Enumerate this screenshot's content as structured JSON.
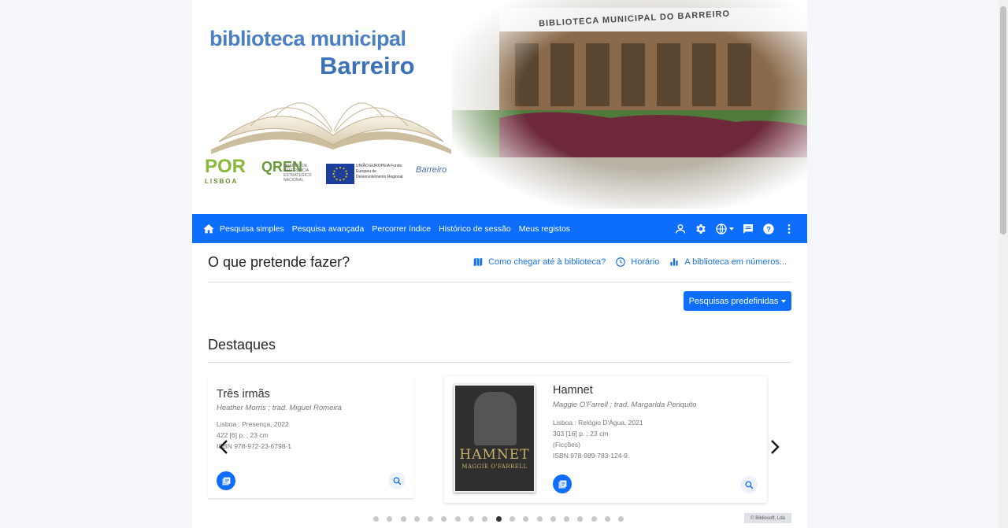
{
  "banner": {
    "brand_line1": "biblioteca municipal",
    "brand_line2": "Barreiro",
    "building_sign": "BIBLIOTECA MUNICIPAL DO BARREIRO",
    "logos": {
      "por": "POR",
      "por_sub": "LISBOA",
      "qren": "QREN",
      "qren_text": "QUADRO DE REFERÊNCIA ESTRATÉGICO NACIONAL",
      "eu_text": "UNIÃO EUROPEIA Fundo Europeu de Desenvolvimento Regional",
      "barreiro": "Barreiro"
    }
  },
  "nav": {
    "links": [
      "Pesquisa simples",
      "Pesquisa avançada",
      "Percorrer índice",
      "Histórico de sessão",
      "Meus registos"
    ],
    "icons": [
      "user-icon",
      "gear-icon",
      "globe-icon",
      "chat-icon",
      "help-icon",
      "more-vertical-icon"
    ]
  },
  "main": {
    "question": "O que pretende fazer?",
    "quick_links": [
      "Como chegar até à biblioteca?",
      "Horário",
      "A biblioteca em números..."
    ],
    "predefined_button": "Pesquisas predefinidas",
    "highlights_title": "Destaques"
  },
  "carousel": {
    "left_card": {
      "title": "Três irmãs",
      "author": "Heather Morris ; trad. Miguel Romeira",
      "meta": [
        "Lisboa : Presença, 2022",
        "422 [6] p. ; 23 cm",
        "ISBN 978-972-23-6798-1"
      ]
    },
    "main_card": {
      "title": "Hamnet",
      "author": "Maggie O'Farrell ; trad. Margarida Periquito",
      "meta": [
        "Lisboa : Relógio D'Água, 2021",
        "303 [16] p. ; 23 cm",
        "(Ficções)",
        "ISBN 978-989-783-124-9"
      ],
      "cover_title": "HAMNET",
      "cover_author": "MAGGIE O'FARRELL"
    },
    "dot_count": 19,
    "active_dot": 9
  },
  "footer": {
    "badge": "© Bibliosoft, Lda"
  }
}
